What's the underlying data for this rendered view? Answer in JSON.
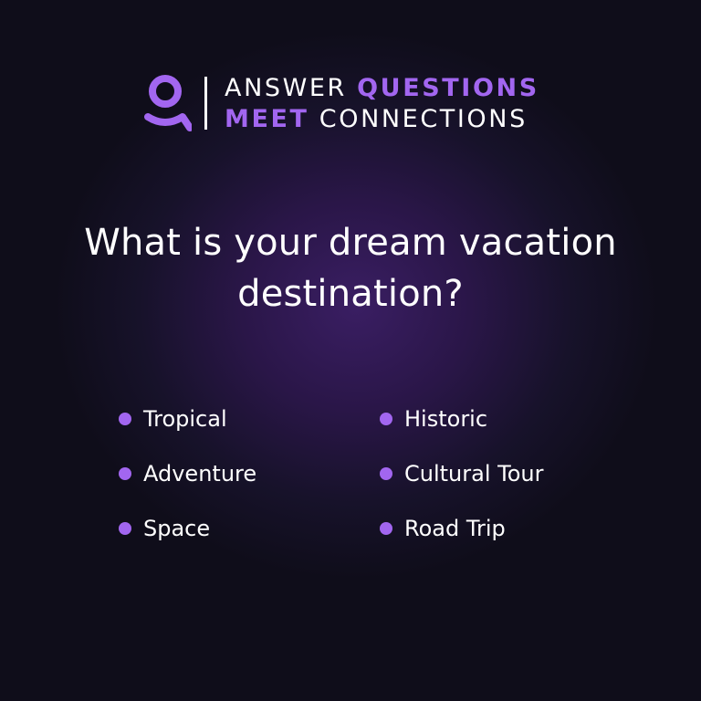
{
  "header": {
    "line1": {
      "word1": "ANSWER",
      "word2": "QUESTIONS"
    },
    "line2": {
      "word1": "MEET",
      "word2": "CONNECTIONS"
    },
    "logo_icon": "person-icon"
  },
  "question": {
    "line1": "What is your dream vacation",
    "line2": "destination?"
  },
  "options": {
    "left": [
      "Tropical",
      "Adventure",
      "Space"
    ],
    "right": [
      "Historic",
      "Cultural Tour",
      "Road Trip"
    ]
  },
  "colors": {
    "accent": "#a266f0",
    "background": "#0d0c16",
    "glow": "#3a1e63",
    "text": "#ffffff"
  }
}
